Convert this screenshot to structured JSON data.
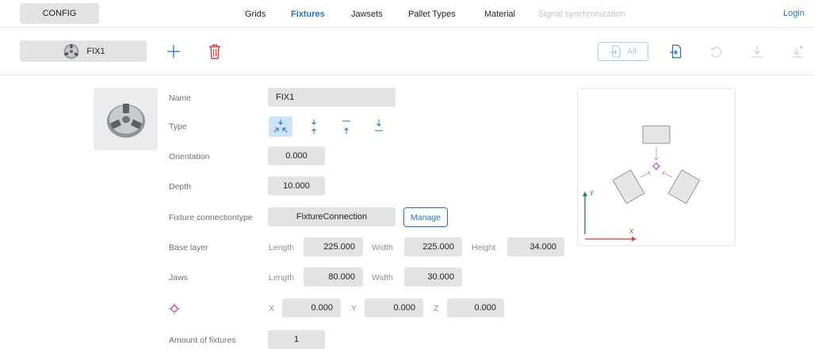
{
  "topbar": {
    "config_label": "CONFIG",
    "nav": [
      {
        "label": "Grids",
        "state": "normal"
      },
      {
        "label": "Fixtures",
        "state": "active"
      },
      {
        "label": "Jawsets",
        "state": "normal"
      },
      {
        "label": "Pallet Types",
        "state": "normal"
      },
      {
        "label": "Material",
        "state": "normal"
      },
      {
        "label": "Signal synchronization",
        "state": "disabled"
      }
    ],
    "login_label": "Login"
  },
  "toolbar": {
    "selected_fixture": "FIX1",
    "all_label": "All",
    "icons": [
      "add-icon",
      "trash-icon",
      "import-all-icon",
      "import-icon",
      "undo-icon",
      "download-icon",
      "download-plus-icon"
    ]
  },
  "form": {
    "name_label": "Name",
    "name_value": "FIX1",
    "type_label": "Type",
    "type_options": [
      "type-inward-icon",
      "type-up-down-icon",
      "type-up-icon",
      "type-down-icon"
    ],
    "type_selected": 0,
    "orientation_label": "Orientation",
    "orientation_value": "0.000",
    "depth_label": "Depth",
    "depth_value": "10.000",
    "connection_label": "Fixture connectiontype",
    "connection_value": "FixtureConnection",
    "manage_label": "Manage",
    "base_layer_label": "Base layer",
    "base_layer": {
      "length_label": "Length",
      "length_value": "225.000",
      "width_label": "Width",
      "width_value": "225.000",
      "height_label": "Height",
      "height_value": "34.000"
    },
    "jaws_label": "Jaws",
    "jaws": {
      "length_label": "Length",
      "length_value": "80.000",
      "width_label": "Width",
      "width_value": "30.000"
    },
    "origin": {
      "x_label": "X",
      "x_value": "0.000",
      "y_label": "Y",
      "y_value": "0.000",
      "z_label": "Z",
      "z_value": "0.000"
    },
    "amount_label": "Amount of fixtures",
    "amount_value": "1"
  },
  "preview": {
    "y_axis_label": "Y",
    "x_axis_label": "X"
  },
  "colors": {
    "accent": "#1f6fd1",
    "origin_marker": "#c23bd4",
    "x_axis": "#e03b3b",
    "y_axis": "#1e8a4a"
  }
}
